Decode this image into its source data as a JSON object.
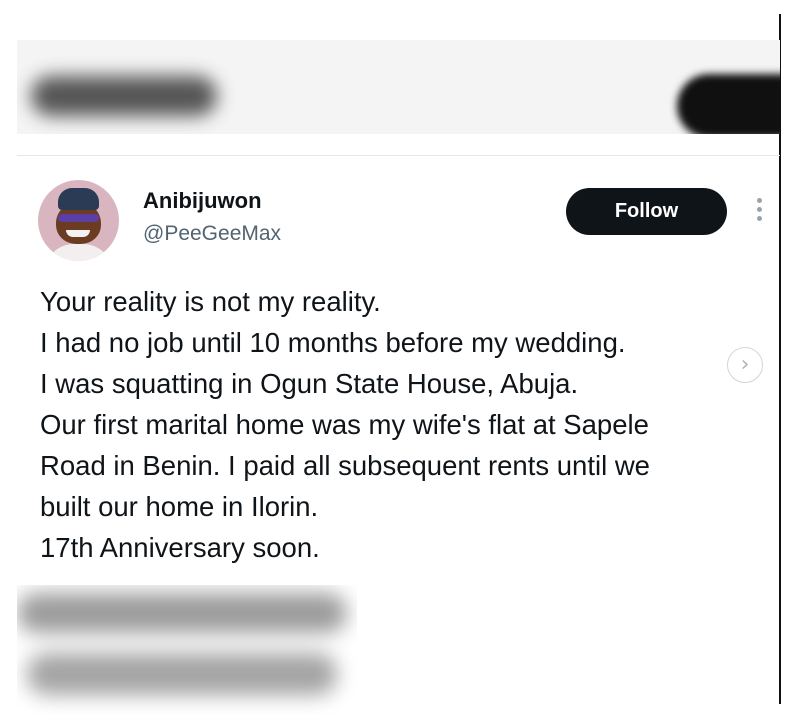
{
  "tweet": {
    "display_name": "Anibijuwon",
    "handle": "@PeeGeeMax",
    "follow_label": "Follow",
    "text_lines": [
      "Your reality is not my reality.",
      "I had no job until 10 months before my wedding.",
      "I was squatting in Ogun State House, Abuja.",
      "Our first marital home was my wife's flat at Sapele",
      "Road in Benin. I paid all subsequent rents until we",
      "built our home in Ilorin.",
      "17th Anniversary soon."
    ]
  },
  "icons": {
    "more": "more-vertical-icon",
    "next": "chevron-right-icon"
  },
  "colors": {
    "follow_button_bg": "#0f1419",
    "follow_button_text": "#ffffff",
    "handle_text": "#536471",
    "avatar_bg": "#d9b6bf"
  }
}
